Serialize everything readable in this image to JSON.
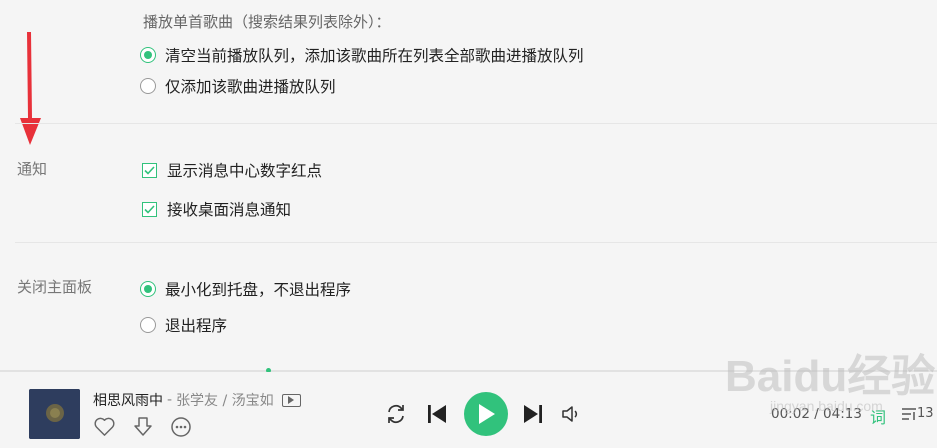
{
  "playmode": {
    "title": "播放单首歌曲（搜索结果列表除外）：",
    "options": [
      {
        "label": "清空当前播放队列，添加该歌曲所在列表全部歌曲进播放队列",
        "selected": true
      },
      {
        "label": "仅添加该歌曲进播放队列",
        "selected": false
      }
    ]
  },
  "notify": {
    "label": "通知",
    "options": [
      {
        "label": "显示消息中心数字红点",
        "checked": true
      },
      {
        "label": "接收桌面消息通知",
        "checked": true
      }
    ]
  },
  "close": {
    "label": "关闭主面板",
    "options": [
      {
        "label": "最小化到托盘，不退出程序",
        "selected": true
      },
      {
        "label": "退出程序",
        "selected": false
      }
    ]
  },
  "player": {
    "title": "相思风雨中",
    "separator": "-",
    "artist": "张学友 / 汤宝如",
    "time": "00:02 / 04:13",
    "lyric": "词",
    "playlist_count": "13",
    "progress": 0.01
  },
  "watermark": {
    "text": "Baidu经验",
    "sub": "jingyan.baidu.com"
  },
  "colors": {
    "accent": "#31c27c",
    "annotation": "#e8313a"
  },
  "icons": [
    "radio-icon",
    "checkbox-icon",
    "red-arrow-icon",
    "heart-icon",
    "download-icon",
    "more-icon",
    "mv-icon",
    "repeat-icon",
    "prev-icon",
    "play-icon",
    "next-icon",
    "volume-icon",
    "playlist-icon"
  ]
}
